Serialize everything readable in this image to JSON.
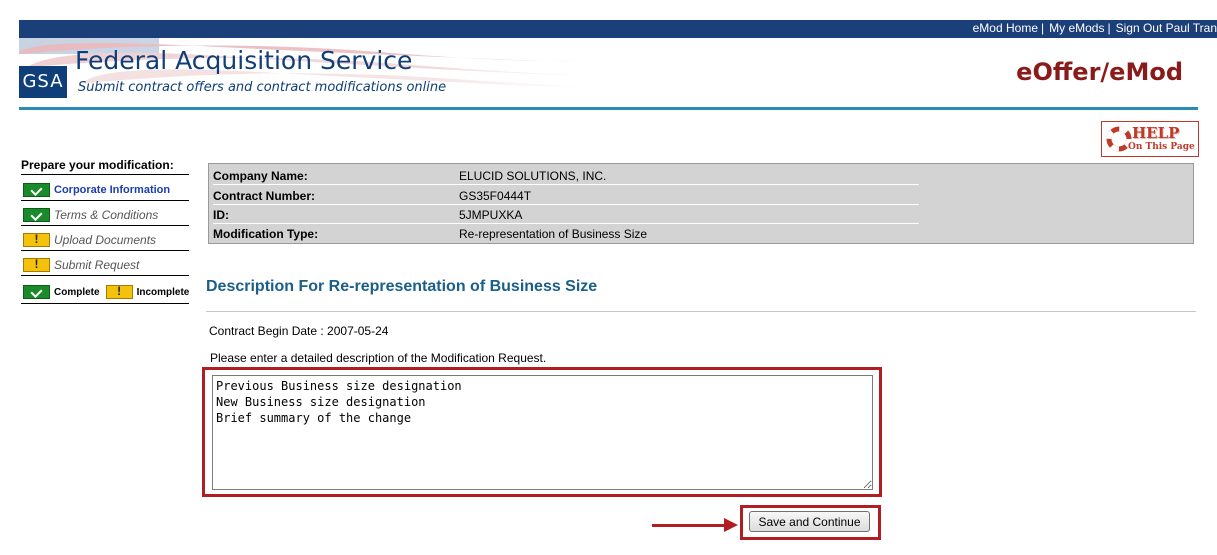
{
  "topnav": {
    "links": [
      "eMod Home",
      "My eMods",
      "Sign Out Paul Tran"
    ],
    "separator": "|"
  },
  "header": {
    "logo_text": "GSA",
    "title": "Federal Acquisition Service",
    "subtitle": "Submit contract offers and contract modifications online",
    "app_name": "eOffer/eMod"
  },
  "help": {
    "label": "HELP",
    "sublabel": "On This Page",
    "icon": "life-ring-icon"
  },
  "sidebar": {
    "title": "Prepare your modification:",
    "items": [
      {
        "label": "Corporate Information",
        "status": "complete",
        "active": true
      },
      {
        "label": "Terms & Conditions",
        "status": "complete",
        "active": false
      },
      {
        "label": "Upload Documents",
        "status": "incomplete",
        "active": false
      },
      {
        "label": "Submit Request",
        "status": "incomplete",
        "active": false
      }
    ],
    "legend": {
      "complete_label": "Complete",
      "incomplete_label": "Incomplete"
    }
  },
  "info": {
    "rows": [
      {
        "label": "Company Name:",
        "value": "ELUCID SOLUTIONS, INC."
      },
      {
        "label": "Contract Number:",
        "value": "GS35F0444T"
      },
      {
        "label": "ID:",
        "value": "5JMPUXKA"
      },
      {
        "label": "Modification Type:",
        "value": "Re-representation of Business Size"
      }
    ]
  },
  "main": {
    "section_title": "Description For Re-representation of Business Size",
    "begin_date": "Contract Begin Date : 2007-05-24",
    "prompt": "Please enter a detailed description of the Modification Request.",
    "description_value": "Previous Business size designation\nNew Business size designation\nBrief summary of the change",
    "save_button_label": "Save and Continue"
  },
  "colors": {
    "brand_navy": "#1b3f79",
    "header_rule": "#2a8bb8",
    "highlight_red": "#b01e23",
    "section_title_blue": "#1a5f8a",
    "info_bg": "#d3d3d3"
  }
}
